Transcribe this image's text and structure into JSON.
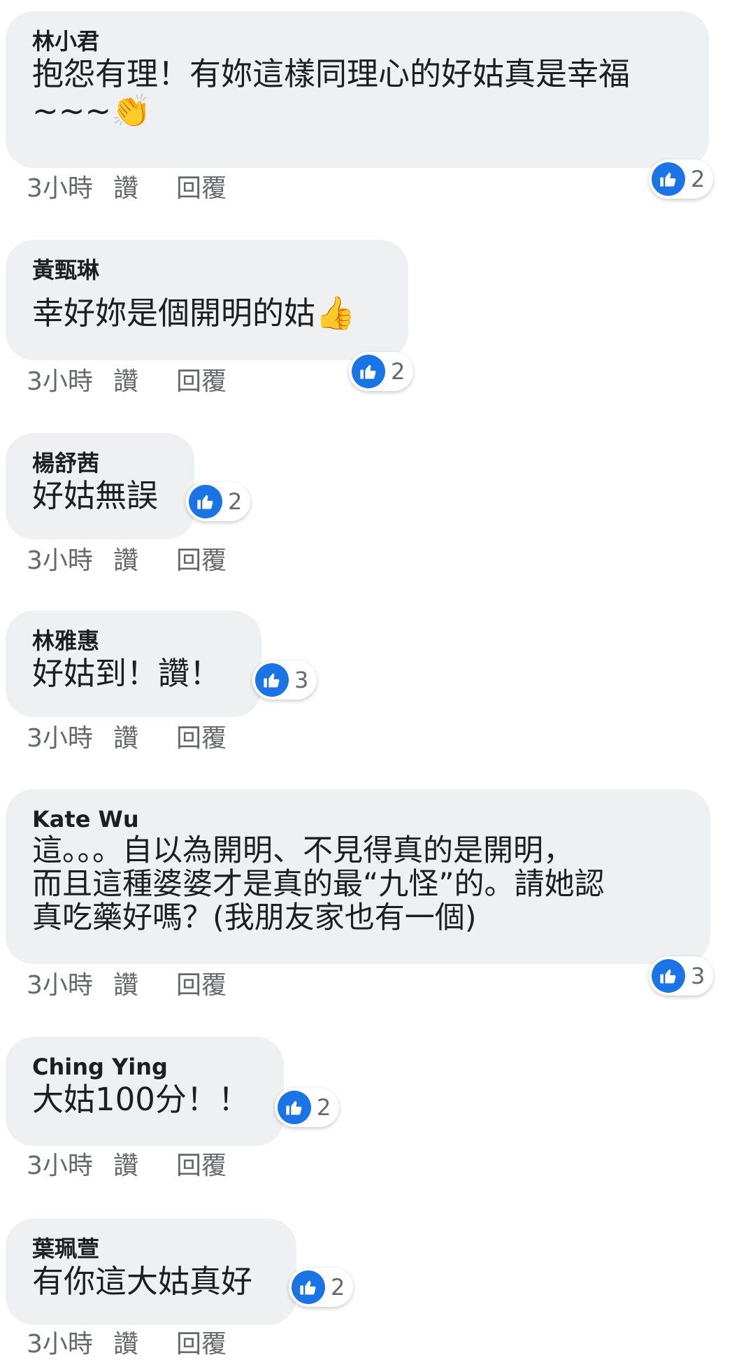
{
  "colors": {
    "bubble": "#eff0f2",
    "like_blue": "#1b74e4",
    "text": "#1c1e21",
    "meta": "#65676b"
  },
  "comments": [
    {
      "author": "林小君",
      "text": "抱怨有理！有妳這樣同理心的好姑真是幸福\n~~~",
      "emoji": "clapping-hands-emoji",
      "emoji_char": "👏",
      "time": "3小時",
      "like_label": "讚",
      "reply_label": "回覆",
      "reaction_icon": "thumbs-up-icon",
      "reaction_count": "2"
    },
    {
      "author": "黃甄琳",
      "text": "幸好妳是個開明的姑",
      "emoji": "thumbs-up-emoji",
      "emoji_char": "👍",
      "time": "3小時",
      "like_label": "讚",
      "reply_label": "回覆",
      "reaction_icon": "thumbs-up-icon",
      "reaction_count": "2"
    },
    {
      "author": "楊舒茜",
      "text": "好姑無誤",
      "time": "3小時",
      "like_label": "讚",
      "reply_label": "回覆",
      "reaction_icon": "thumbs-up-icon",
      "reaction_count": "2"
    },
    {
      "author": "林雅惠",
      "text": "好姑到！讚！",
      "time": "3小時",
      "like_label": "讚",
      "reply_label": "回覆",
      "reaction_icon": "thumbs-up-icon",
      "reaction_count": "3"
    },
    {
      "author": "Kate Wu",
      "text": "這。。。自以為開明、不見得真的是開明，\n而且這種婆婆才是真的最“九怪”的。請她認\n真吃藥好嗎？(我朋友家也有一個)",
      "time": "3小時",
      "like_label": "讚",
      "reply_label": "回覆",
      "reaction_icon": "thumbs-up-icon",
      "reaction_count": "3"
    },
    {
      "author": "Ching Ying",
      "text": "大姑100分！！",
      "time": "3小時",
      "like_label": "讚",
      "reply_label": "回覆",
      "reaction_icon": "thumbs-up-icon",
      "reaction_count": "2"
    },
    {
      "author": "葉珮萱",
      "text": "有你這大姑真好",
      "time": "3小時",
      "like_label": "讚",
      "reply_label": "回覆",
      "reaction_icon": "thumbs-up-icon",
      "reaction_count": "2"
    }
  ]
}
